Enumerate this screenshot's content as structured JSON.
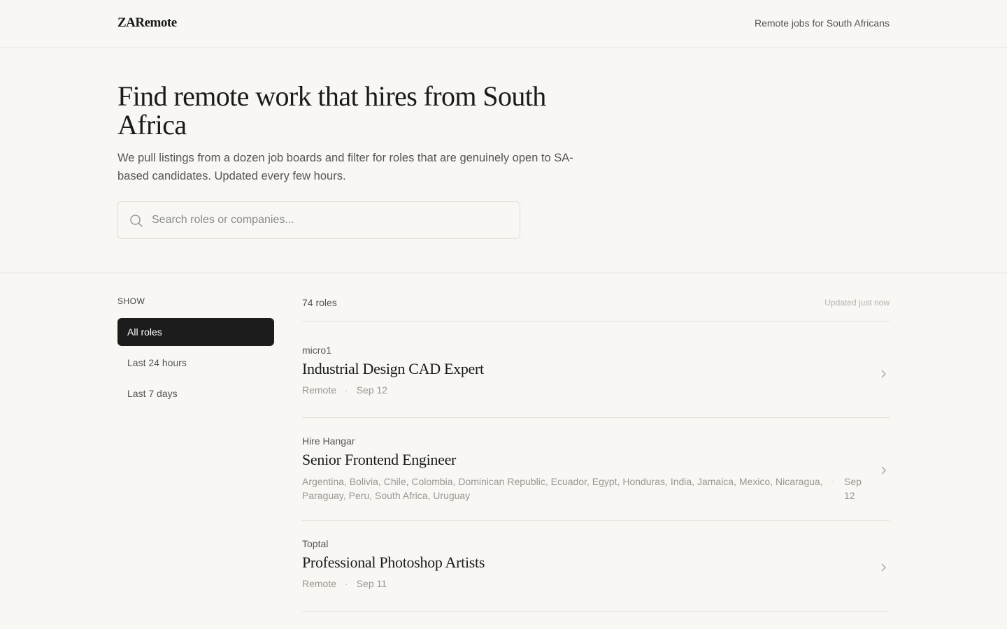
{
  "header": {
    "logo": "ZARemote",
    "tagline": "Remote jobs for South Africans"
  },
  "hero": {
    "title": "Find remote work that hires from South Africa",
    "subtitle": "We pull listings from a dozen job boards and filter for roles that are genuinely open to SA-based candidates. Updated every few hours."
  },
  "search": {
    "placeholder": "Search roles or companies...",
    "value": ""
  },
  "sidebar": {
    "heading": "SHOW",
    "filters": [
      {
        "label": "All roles",
        "active": true
      },
      {
        "label": "Last 24 hours",
        "active": false
      },
      {
        "label": "Last 7 days",
        "active": false
      }
    ]
  },
  "results": {
    "count": "74 roles",
    "updated": "Updated just now",
    "jobs": [
      {
        "company": "micro1",
        "title": "Industrial Design CAD Expert",
        "location": "Remote",
        "separator": "·",
        "date": "Sep 12"
      },
      {
        "company": "Hire Hangar",
        "title": "Senior Frontend Engineer",
        "location": "Argentina, Bolivia, Chile, Colombia, Dominican Republic, Ecuador, Egypt, Honduras, India, Jamaica, Mexico, Nicaragua, Paraguay, Peru, South Africa, Uruguay",
        "separator": "·",
        "date": "Sep 12"
      },
      {
        "company": "Toptal",
        "title": "Professional Photoshop Artists",
        "location": "Remote",
        "separator": "·",
        "date": "Sep 11"
      }
    ]
  },
  "colors": {
    "background": "#f8f7f4",
    "text": "#1c1c1c",
    "muted": "#555555",
    "active_filter_bg": "#1c1c1c",
    "border": "#e3e1dc"
  },
  "icons": {
    "search": "search-icon",
    "chevron": "chevron-right-icon"
  }
}
